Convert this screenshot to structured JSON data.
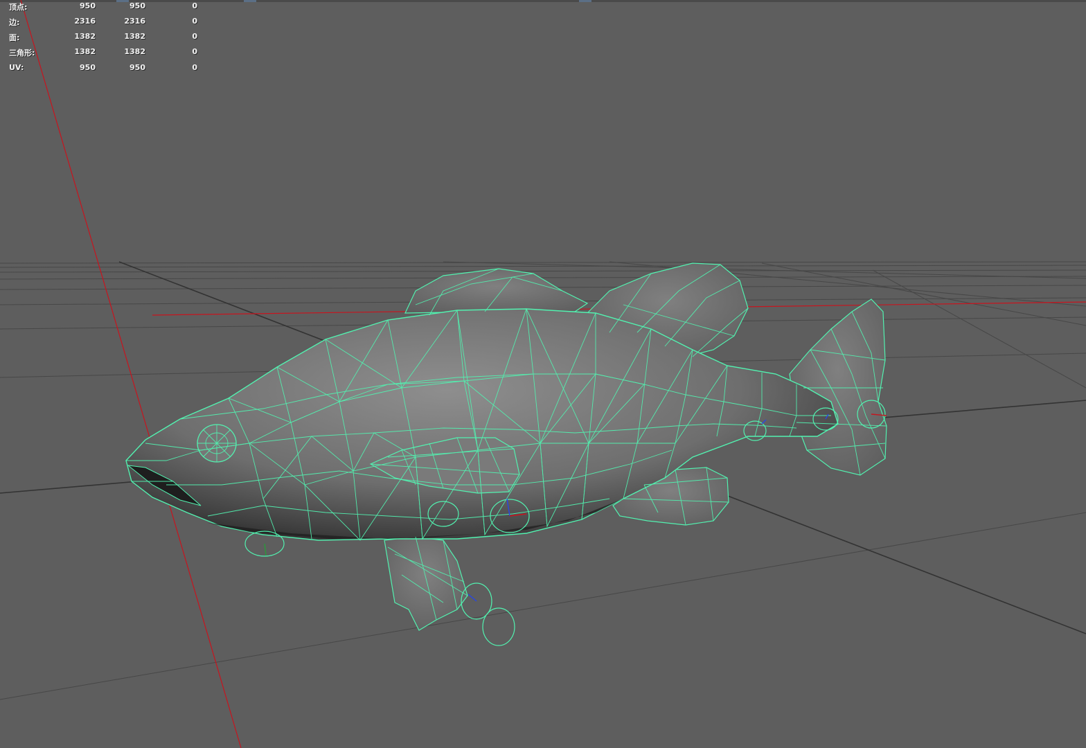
{
  "hud": {
    "rows": [
      {
        "label": "顶点:",
        "v1": "950",
        "v2": "950",
        "v3": "0"
      },
      {
        "label": "边:",
        "v1": "2316",
        "v2": "2316",
        "v3": "0"
      },
      {
        "label": "面:",
        "v1": "1382",
        "v2": "1382",
        "v3": "0"
      },
      {
        "label": "三角形:",
        "v1": "1382",
        "v2": "1382",
        "v3": "0"
      },
      {
        "label": "UV:",
        "v1": "950",
        "v2": "950",
        "v3": "0"
      }
    ]
  },
  "colors": {
    "viewport_bg": "#5e5e5e",
    "wireframe": "#52f2b0",
    "axis_x": "#c8141e",
    "grid": "#474747",
    "grid_bold": "#333333",
    "manip_blue": "#2846e6"
  },
  "scene": {
    "object": "fish-mesh",
    "display_mode": "wireframe-on-shaded"
  }
}
